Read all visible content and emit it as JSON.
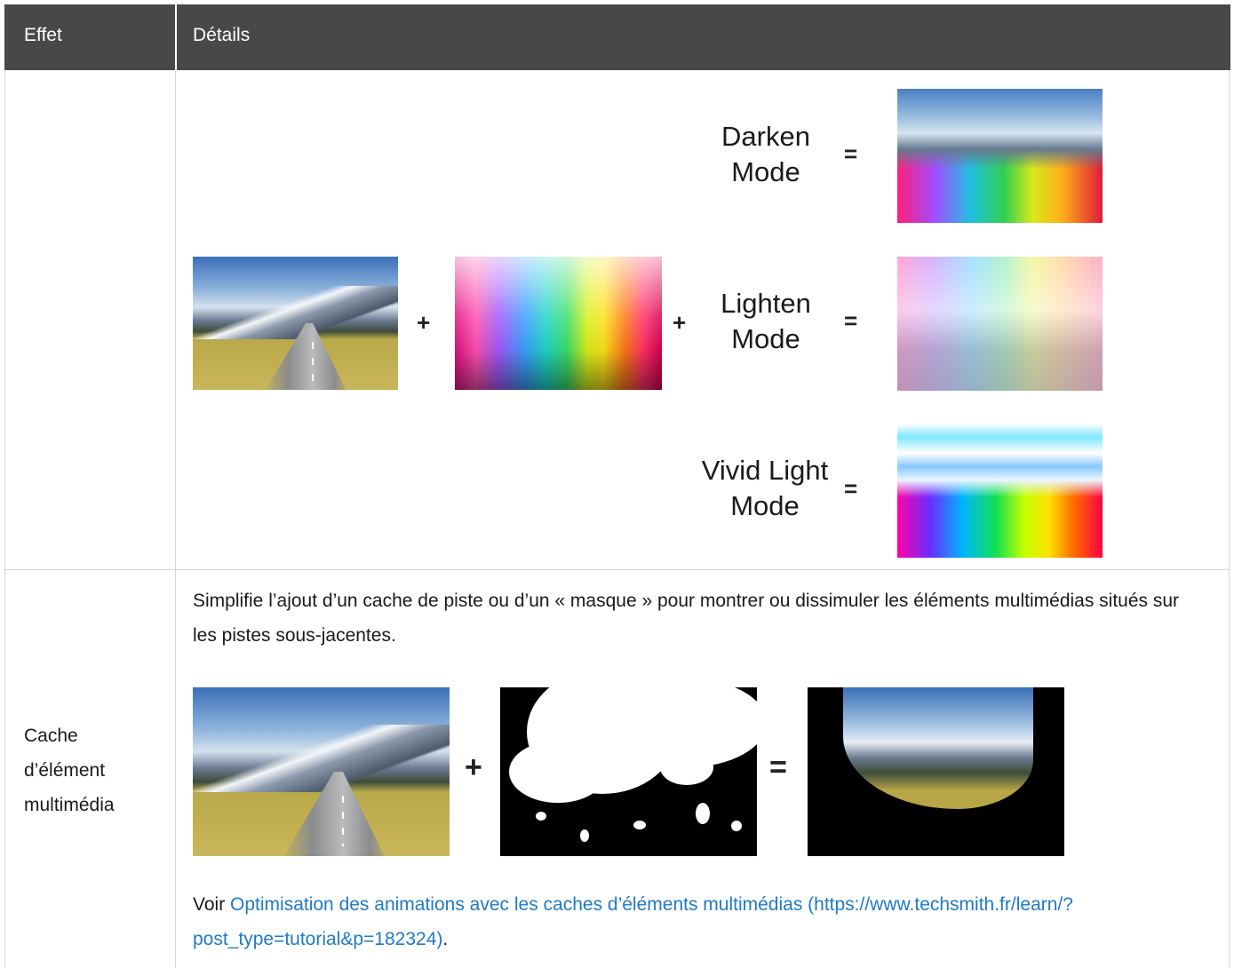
{
  "header": {
    "col1": "Effet",
    "col2": "Détails"
  },
  "blend_row": {
    "plus": "+",
    "equals": "=",
    "modes": [
      {
        "line1": "Darken",
        "line2": "Mode"
      },
      {
        "line1": "Lighten",
        "line2": "Mode"
      },
      {
        "line1": "Vivid Light",
        "line2": "Mode"
      }
    ]
  },
  "media_matte_row": {
    "label": "Cache d’élément multimédia",
    "description": "Simplifie l’ajout d’un cache de piste ou d’un « masque » pour montrer ou dissimuler les éléments multimédias situés sur les pistes sous-jacentes.",
    "plus": "+",
    "equals": "=",
    "see_prefix": "Voir ",
    "link_text": "Optimisation des animations avec les caches d’éléments multimédias (https://www.techsmith.fr/learn/?post_type=tutorial&p=182324)",
    "see_suffix": "."
  },
  "colors": {
    "header_bg": "#484848",
    "link": "#1f7ac4",
    "border": "#d6d6d6"
  }
}
